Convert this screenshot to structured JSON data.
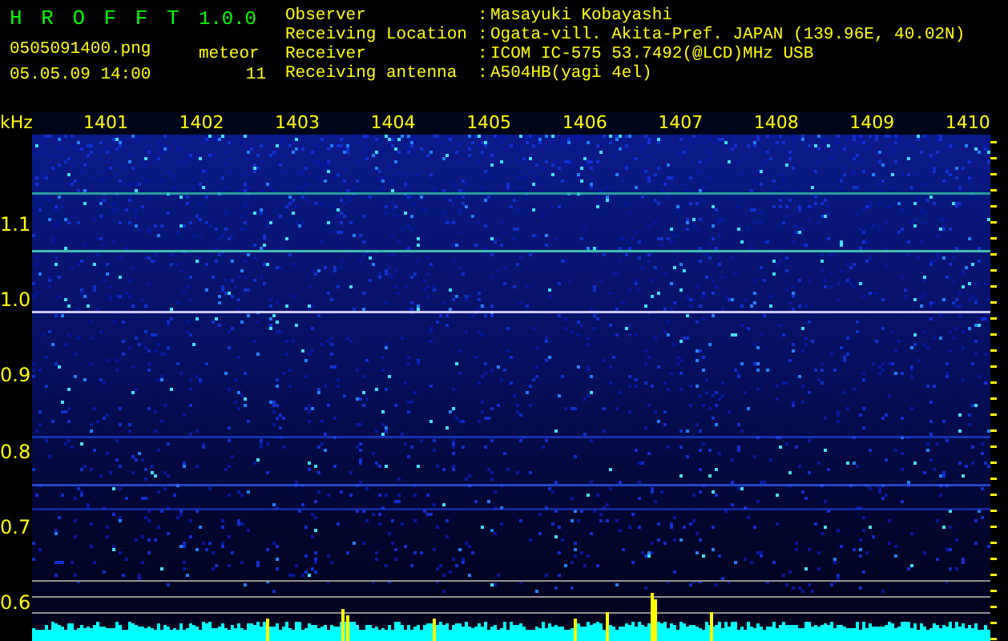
{
  "app": {
    "title": "H R O F F T",
    "version": "1.0.0"
  },
  "file": {
    "name": "0505091400.png",
    "datetime": "05.05.09 14:00"
  },
  "meteor": {
    "label": "meteor",
    "count": "11"
  },
  "info": [
    {
      "label": "Observer",
      "colon": ":",
      "value": "Masayuki Kobayashi"
    },
    {
      "label": "Receiving Location",
      "colon": ":",
      "value": "Ogata-vill. Akita-Pref. JAPAN (139.96E, 40.02N)"
    },
    {
      "label": "Receiver",
      "colon": ":",
      "value": "ICOM IC-575 53.7492(@LCD)MHz USB"
    },
    {
      "label": "Receiving antenna",
      "colon": ":",
      "value": "A504HB(yagi 4el)"
    }
  ],
  "spectrogram": {
    "unit": "kHz",
    "time_labels": [
      "1401",
      "1402",
      "1403",
      "1404",
      "1405",
      "1406",
      "1407",
      "1408",
      "1409",
      "1410"
    ],
    "freq_labels": [
      "1.1",
      "1.0",
      "0.9",
      "0.8",
      "0.7",
      "0.6"
    ]
  }
}
